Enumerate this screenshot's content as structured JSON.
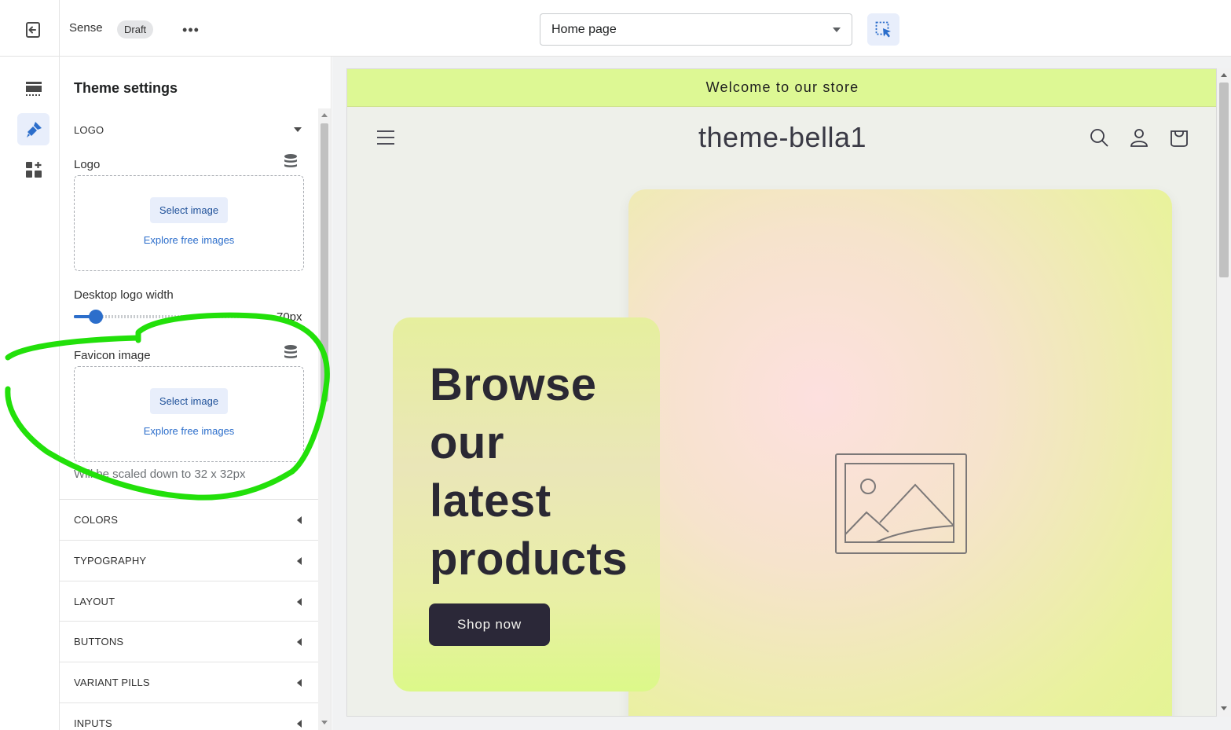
{
  "topbar": {
    "theme_name": "Sense",
    "status_badge": "Draft",
    "more_label": "•••",
    "page_selector": "Home page"
  },
  "rail": {
    "icons": [
      "sections-icon",
      "brush-icon",
      "apps-add-icon"
    ]
  },
  "settings": {
    "title": "Theme settings",
    "logo_section": "LOGO",
    "logo_label": "Logo",
    "select_image": "Select image",
    "explore_free_images": "Explore free images",
    "desktop_logo_width_label": "Desktop logo width",
    "desktop_logo_width_value": "70px",
    "desktop_logo_width_fraction": 0.1,
    "favicon_label": "Favicon image",
    "favicon_help": "Will be scaled down to 32 x 32px",
    "collapsed_sections": [
      "COLORS",
      "TYPOGRAPHY",
      "LAYOUT",
      "BUTTONS",
      "VARIANT PILLS",
      "INPUTS"
    ]
  },
  "preview": {
    "announcement": "Welcome to our store",
    "store_title": "theme-bella1",
    "hero_heading_lines": [
      "Browse",
      "our",
      "latest",
      "products"
    ],
    "shop_button": "Shop now"
  },
  "colors": {
    "accent_blue": "#2c6ecb",
    "announcement_bg": "#ddf894",
    "annotation_green": "#22e00a",
    "button_dark": "#2b2838"
  }
}
